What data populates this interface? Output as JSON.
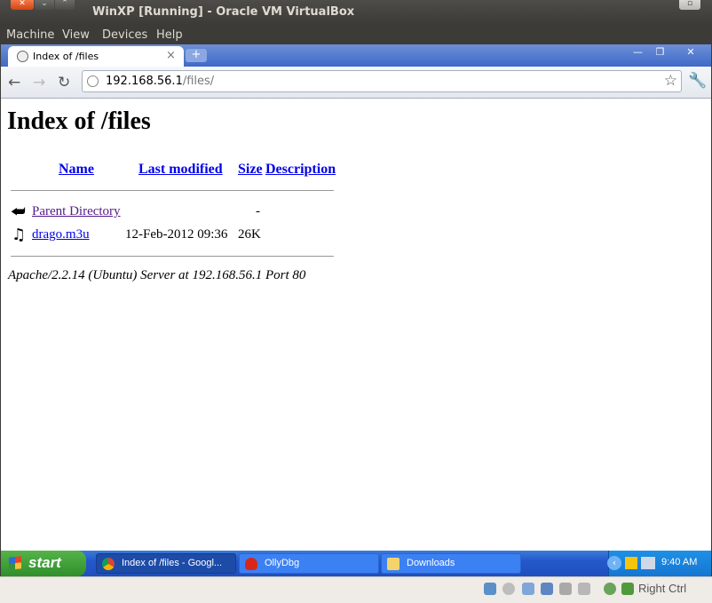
{
  "host": {
    "window_title": "WinXP [Running] - Oracle VM VirtualBox",
    "menu": [
      "Machine",
      "View",
      "Devices",
      "Help"
    ],
    "menu_underline": [
      "M",
      "V",
      "D",
      "H"
    ],
    "status": {
      "host_key": "Right Ctrl"
    }
  },
  "browser": {
    "tab_title": "Index of /files",
    "url_host": "192.168.56.1",
    "url_path": "/files/"
  },
  "page": {
    "heading": "Index of /files",
    "columns": [
      "Name",
      "Last modified",
      "Size",
      "Description"
    ],
    "rows": [
      {
        "name": "Parent Directory",
        "modified": "",
        "size": "-",
        "icon": "back-arrow-icon"
      },
      {
        "name": "drago.m3u",
        "modified": "12-Feb-2012 09:36",
        "size": "26K",
        "icon": "music-note-icon"
      }
    ],
    "address": "Apache/2.2.14 (Ubuntu) Server at 192.168.56.1 Port 80"
  },
  "taskbar": {
    "start_label": "start",
    "tasks": [
      {
        "label": "Index of /files - Googl...",
        "icon": "chrome-icon",
        "active": true
      },
      {
        "label": "OllyDbg",
        "icon": "ollydbg-bug-icon",
        "active": false
      },
      {
        "label": "Downloads",
        "icon": "folder-icon",
        "active": false
      }
    ],
    "clock": "9:40 AM"
  },
  "colors": {
    "link": "#0000ee",
    "visited": "#551a8b",
    "xp_taskbar": "#2458c9",
    "xp_start": "#3a9a34",
    "ubuntu_close": "#e0561f"
  }
}
